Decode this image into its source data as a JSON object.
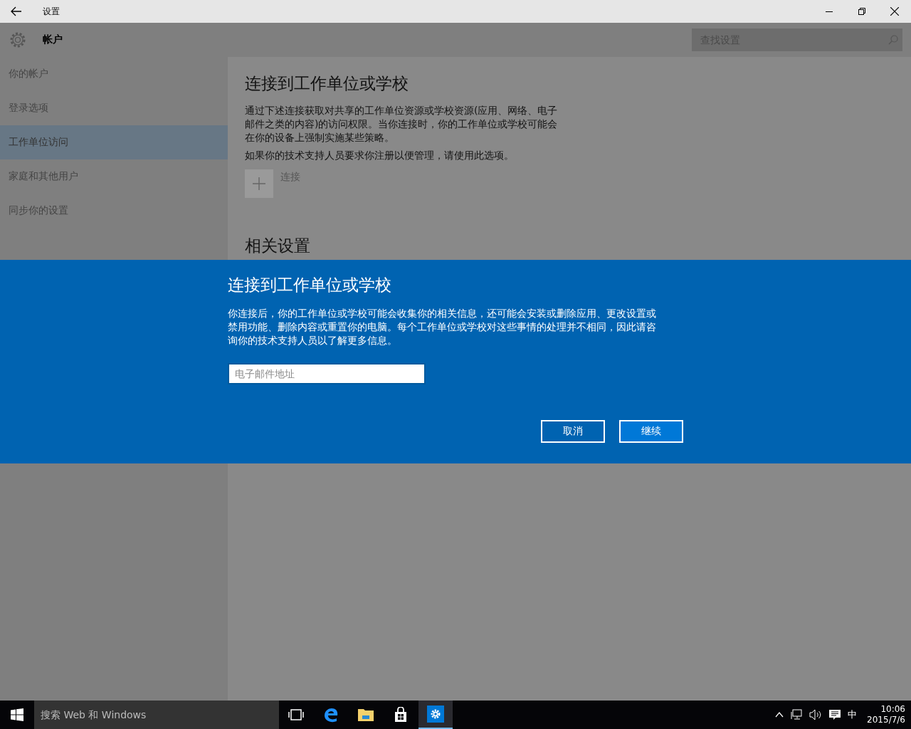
{
  "window": {
    "title": "设置"
  },
  "header": {
    "title": "帐户",
    "search": {
      "placeholder": "查找设置"
    }
  },
  "sidebar": {
    "items": [
      {
        "label": "你的帐户",
        "selected": false
      },
      {
        "label": "登录选项",
        "selected": false
      },
      {
        "label": "工作单位访问",
        "selected": true
      },
      {
        "label": "家庭和其他用户",
        "selected": false
      },
      {
        "label": "同步你的设置",
        "selected": false
      }
    ]
  },
  "content": {
    "title": "连接到工作单位或学校",
    "description": "通过下述连接获取对共享的工作单位资源或学校资源(应用、网络、电子邮件之类的内容)的访问权限。当你连接时，你的工作单位或学校可能会在你的设备上强制实施某些策略。",
    "note": "如果你的技术支持人员要求你注册以便管理，请使用此选项。",
    "connect_label": "连接",
    "related_heading": "相关设置"
  },
  "dialog": {
    "title": "连接到工作单位或学校",
    "message": "你连接后，你的工作单位或学校可能会收集你的相关信息，还可能会安装或删除应用、更改设置或禁用功能、删除内容或重置你的电脑。每个工作单位或学校对这些事情的处理并不相同，因此请咨询你的技术支持人员以了解更多信息。",
    "email": {
      "placeholder": "电子邮件地址"
    },
    "buttons": [
      {
        "label": "取消",
        "kind": "secondary"
      },
      {
        "label": "继续",
        "kind": "primary"
      }
    ]
  },
  "taskbar": {
    "search": {
      "placeholder": "搜索 Web 和 Windows"
    },
    "apps": [
      {
        "kind": "taskview",
        "selected": false
      },
      {
        "kind": "edge",
        "selected": false
      },
      {
        "kind": "explorer",
        "selected": false
      },
      {
        "kind": "store",
        "selected": false
      },
      {
        "kind": "settings",
        "selected": true
      }
    ],
    "input_language": "中",
    "time": "10:06",
    "date": "2015/7/6"
  }
}
